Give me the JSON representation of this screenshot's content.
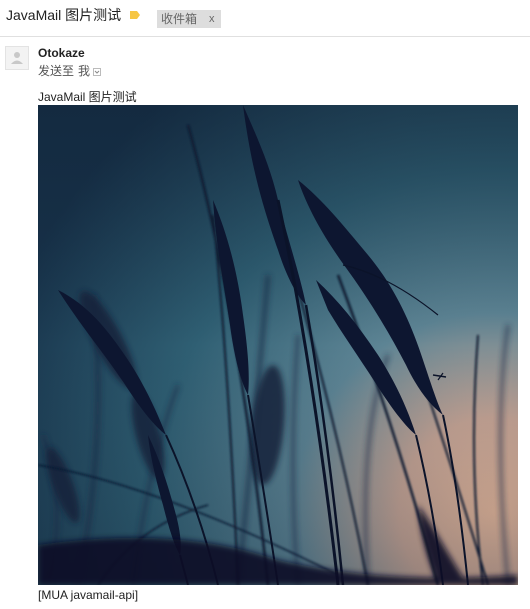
{
  "header": {
    "subject": "JavaMail 图片测试",
    "label_icon": "label-tag-icon",
    "label_color": "#f6c644",
    "chip_label": "收件箱",
    "chip_close": "x"
  },
  "message": {
    "sender": "Otokaze",
    "to_prefix": "发送至",
    "to_name": "我",
    "avatar_icon": "person-icon",
    "body_text": "JavaMail 图片测试",
    "image_icon": "wheat-silhouette-photo",
    "footer_text": "[MUA javamail-api]"
  }
}
